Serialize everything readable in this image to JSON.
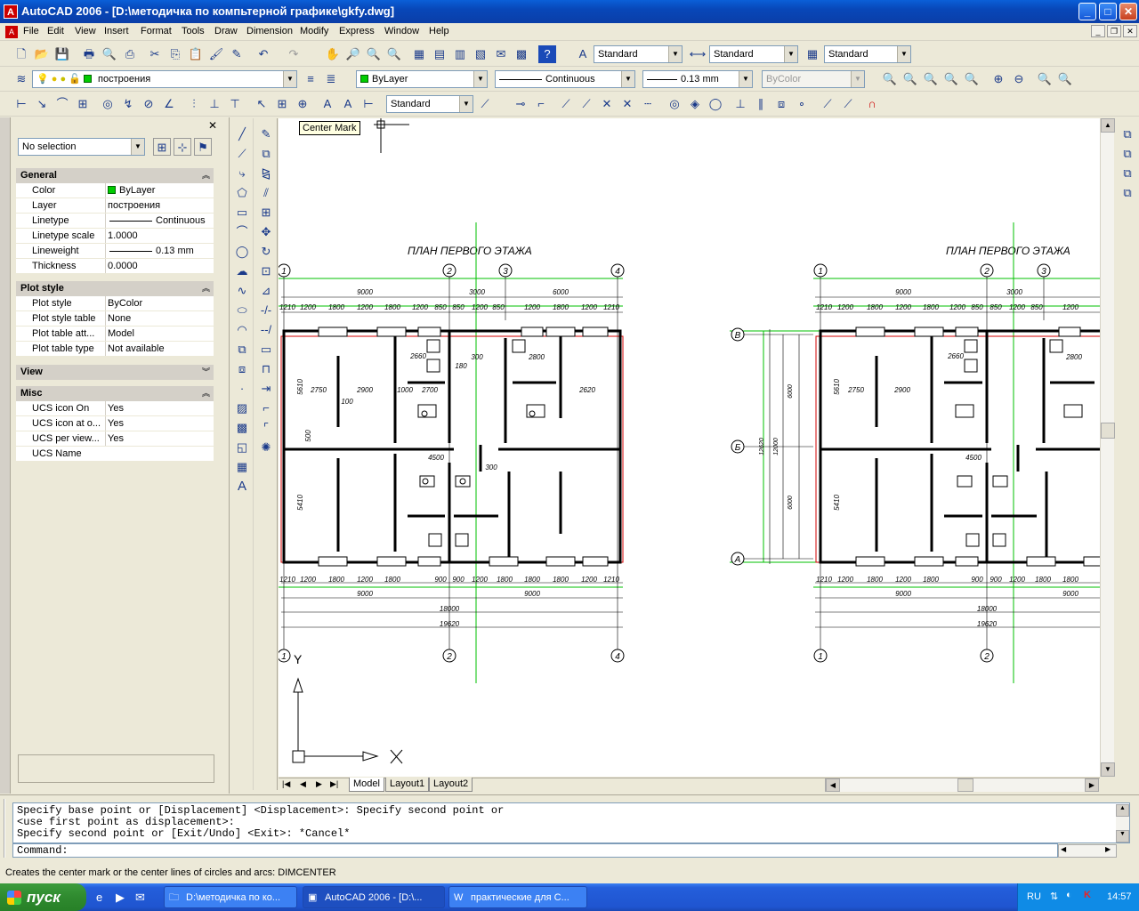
{
  "window": {
    "title": "AutoCAD 2006 - [D:\\методичка по компьтерной графике\\gkfy.dwg]",
    "app_icon": "A"
  },
  "menu": [
    "File",
    "Edit",
    "View",
    "Insert",
    "Format",
    "Tools",
    "Draw",
    "Dimension",
    "Modify",
    "Express",
    "Window",
    "Help"
  ],
  "toolbar_styles": {
    "text_style": "Standard",
    "dim_style": "Standard",
    "table_style": "Standard"
  },
  "layers": {
    "current_layer": "построения",
    "color": "ByLayer",
    "linetype": "Continuous",
    "lineweight": "0.13 mm",
    "plotstyle": "ByColor"
  },
  "dim_toolbar": {
    "dim_style": "Standard"
  },
  "properties": {
    "selection": "No selection",
    "sections": [
      {
        "title": "General",
        "rows": [
          {
            "k": "Color",
            "v": "ByLayer"
          },
          {
            "k": "Layer",
            "v": "построения"
          },
          {
            "k": "Linetype",
            "v": "Continuous"
          },
          {
            "k": "Linetype scale",
            "v": "1.0000"
          },
          {
            "k": "Lineweight",
            "v": "0.13 mm"
          },
          {
            "k": "Thickness",
            "v": "0.0000"
          }
        ]
      },
      {
        "title": "Plot style",
        "rows": [
          {
            "k": "Plot style",
            "v": "ByColor"
          },
          {
            "k": "Plot style table",
            "v": "None"
          },
          {
            "k": "Plot table att...",
            "v": "Model"
          },
          {
            "k": "Plot table type",
            "v": "Not available"
          }
        ]
      },
      {
        "title": "View",
        "rows": []
      },
      {
        "title": "Misc",
        "rows": [
          {
            "k": "UCS icon On",
            "v": "Yes"
          },
          {
            "k": "UCS icon at o...",
            "v": "Yes"
          },
          {
            "k": "UCS per view...",
            "v": "Yes"
          },
          {
            "k": "UCS Name",
            "v": ""
          }
        ]
      }
    ]
  },
  "tooltip": "Center Mark",
  "drawing": {
    "plan_title": "ПЛАН ПЕРВОГО ЭТАЖА",
    "axes_top": [
      "1",
      "2",
      "3",
      "4"
    ],
    "axes_side": [
      "В",
      "Б",
      "А"
    ],
    "dims_top": [
      "9000",
      "3000",
      "6000"
    ],
    "dims_top_small": [
      "1210",
      "1200",
      "1800",
      "1200",
      "1800",
      "1200",
      "850",
      "850",
      "1200",
      "850",
      "1200",
      "1800",
      "1200",
      "1210"
    ],
    "dims_bottom": [
      "1210",
      "1200",
      "1800",
      "1200",
      "1800",
      "900",
      "900",
      "1200",
      "1800",
      "1800",
      "1800",
      "1200",
      "1210"
    ],
    "dims_bottom_total": [
      "9000",
      "9000",
      "18000",
      "19620"
    ],
    "room_dims": [
      "2750",
      "2900",
      "2660",
      "1000",
      "2700",
      "2620",
      "4500",
      "2800",
      "300",
      "180",
      "100",
      "300",
      "5610",
      "5410",
      "500"
    ],
    "side_dims": [
      "6000",
      "6000",
      "12000",
      "12620"
    ],
    "ucs_x": "X",
    "ucs_y": "Y"
  },
  "layout_tabs": [
    "Model",
    "Layout1",
    "Layout2"
  ],
  "command_history": [
    "Specify base point or [Displacement] <Displacement>: Specify second point or",
    "<use first point as displacement>:",
    "Specify second point or [Exit/Undo] <Exit>: *Cancel*"
  ],
  "command_prompt": "Command:",
  "status_text": "Creates the center mark or the center lines of circles and arcs:  DIMCENTER",
  "taskbar": {
    "start": "пуск",
    "tasks": [
      "D:\\методичка по ко...",
      "AutoCAD 2006 - [D:\\...",
      "практические для С..."
    ],
    "lang": "RU",
    "clock": "14:57"
  },
  "colors": {
    "titlebar": "#0a3ea8",
    "accent_green": "#00c000",
    "wall": "#000000",
    "red_line": "#d00000"
  }
}
